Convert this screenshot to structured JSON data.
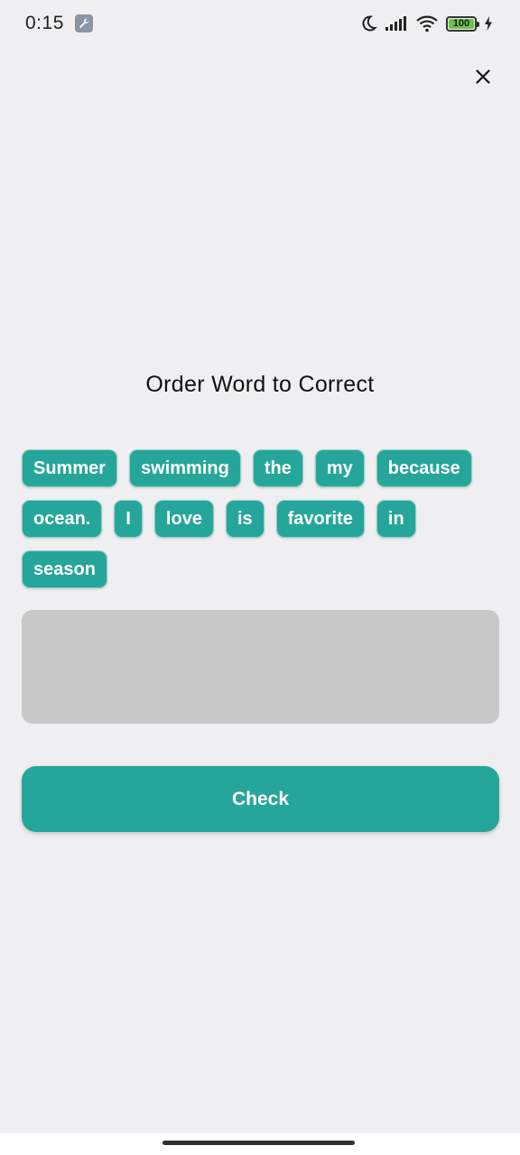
{
  "status_bar": {
    "time": "0:15",
    "battery_level": "100",
    "icons": [
      "wrench-icon",
      "moon-icon",
      "signal-icon",
      "wifi-icon",
      "battery-icon",
      "charging-bolt-icon"
    ]
  },
  "header": {
    "close_icon": "close-icon"
  },
  "exercise": {
    "title": "Order Word to Correct",
    "words": [
      "Summer",
      "swimming",
      "the",
      "my",
      "because",
      "ocean.",
      "I",
      "love",
      "is",
      "favorite",
      "in",
      "season"
    ]
  },
  "actions": {
    "check_label": "Check"
  },
  "colors": {
    "accent": "#26a69a",
    "background": "#efeef0",
    "answer_area": "#c8c8c8"
  }
}
